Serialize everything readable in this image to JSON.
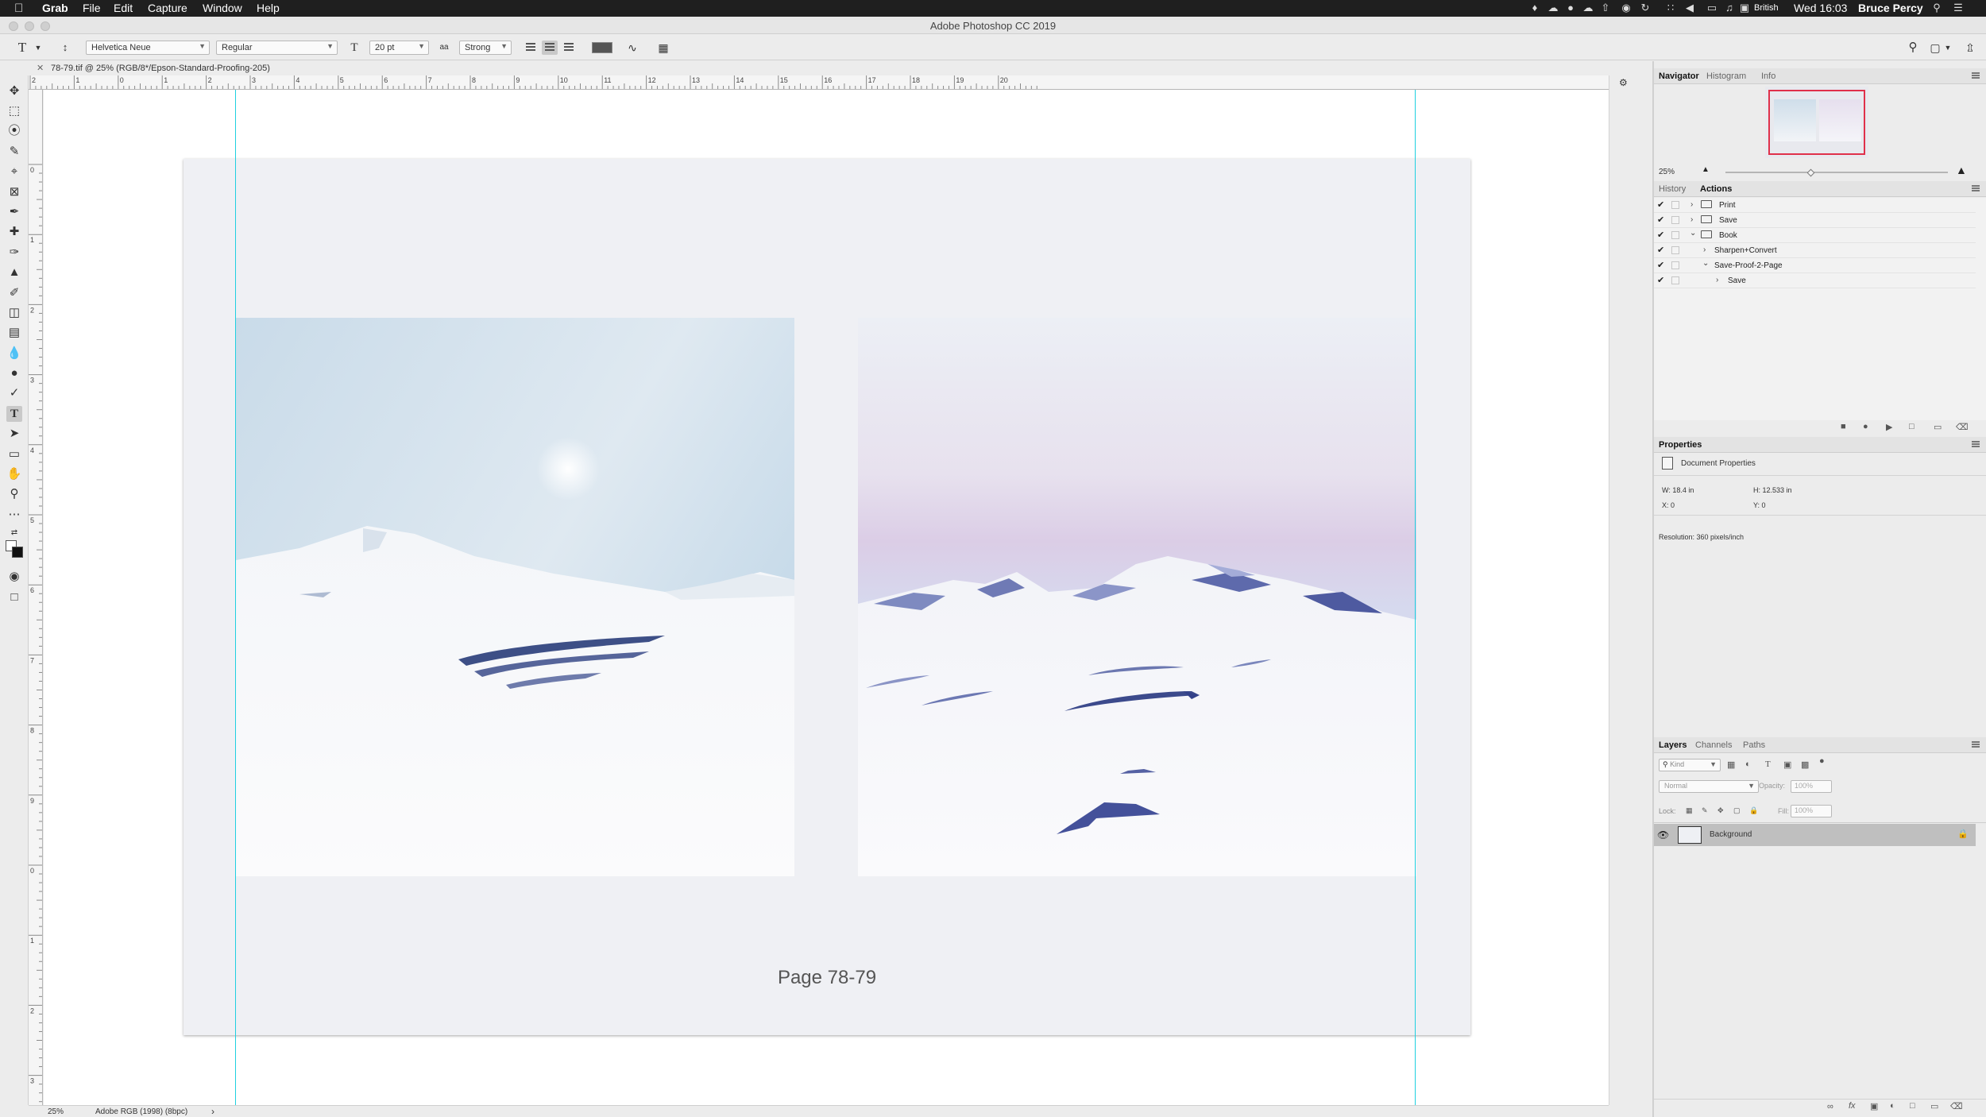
{
  "menubar": {
    "apple": "",
    "items": [
      "Grab",
      "File",
      "Edit",
      "Capture",
      "Window",
      "Help"
    ],
    "language": "British",
    "clock": "Wed 16:03",
    "user": "Bruce Percy"
  },
  "window": {
    "title": "Adobe Photoshop CC 2019"
  },
  "options": {
    "font_family": "Helvetica Neue",
    "font_style": "Regular",
    "font_size": "20 pt",
    "antialias_label": "aa",
    "antialias": "Strong"
  },
  "doc_tab": {
    "name": "78-79.tif @ 25% (RGB/8*/Epson-Standard-Proofing-205)"
  },
  "rulers": {
    "h_labels": [
      "2",
      "1",
      "0",
      "1",
      "2",
      "3",
      "4",
      "5",
      "6",
      "7",
      "8",
      "9",
      "10",
      "11",
      "12",
      "13",
      "14",
      "15",
      "16",
      "17",
      "18",
      "19",
      "20"
    ],
    "v_labels": [
      "0",
      "1",
      "2",
      "3",
      "4",
      "5",
      "6",
      "7",
      "8",
      "9",
      "0",
      "1",
      "2",
      "3"
    ]
  },
  "canvas": {
    "caption": "Page 78-79"
  },
  "statusbar": {
    "zoom": "25%",
    "profile": "Adobe RGB (1998) (8bpc)",
    "arrow": "›"
  },
  "navigator": {
    "tabs": [
      "Navigator",
      "Histogram",
      "Info"
    ],
    "zoom": "25%"
  },
  "actions_panel": {
    "tabs": [
      "History",
      "Actions"
    ],
    "rows": [
      {
        "label": "Print",
        "kind": "set",
        "expanded": false
      },
      {
        "label": "Save",
        "kind": "set",
        "expanded": false
      },
      {
        "label": "Book",
        "kind": "set",
        "expanded": true
      },
      {
        "label": "Sharpen+Convert",
        "kind": "action",
        "expanded": false
      },
      {
        "label": "Save-Proof-2-Page",
        "kind": "action",
        "expanded": true
      },
      {
        "label": "Save",
        "kind": "step",
        "expanded": false
      }
    ]
  },
  "properties": {
    "tab": "Properties",
    "header": "Document Properties",
    "w": "W: 18.4 in",
    "h": "H: 12.533 in",
    "x": "X: 0",
    "y": "Y: 0",
    "resolution": "Resolution: 360 pixels/inch"
  },
  "layers": {
    "tabs": [
      "Layers",
      "Channels",
      "Paths"
    ],
    "kind_placeholder": "Kind",
    "blend_mode": "Normal",
    "opacity_label": "Opacity:",
    "opacity": "100%",
    "lock_label": "Lock:",
    "fill_label": "Fill:",
    "fill": "100%",
    "layer_name": "Background"
  },
  "colors": {
    "accent_guide": "#1fd0e0",
    "nav_box": "#e0304a",
    "menubar_bg": "#1f1f1f"
  }
}
